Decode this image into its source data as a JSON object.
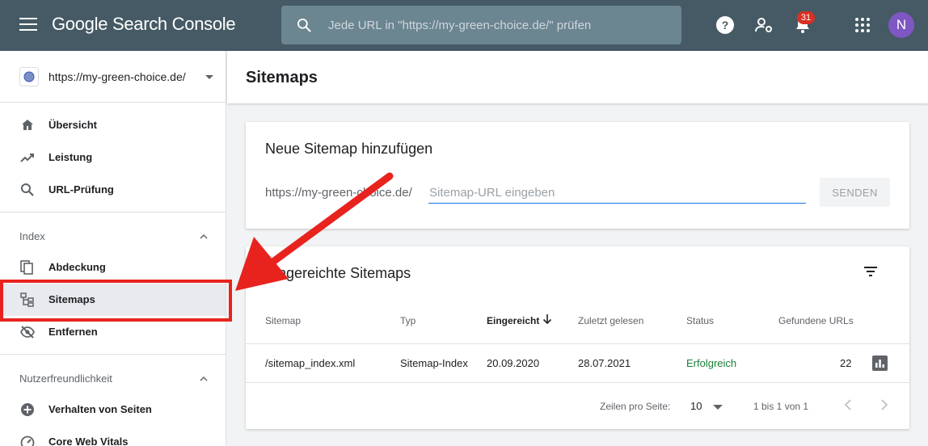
{
  "app": {
    "title": "Google Search Console",
    "search_placeholder": "Jede URL in \"https://my-green-choice.de/\" prüfen",
    "notifications_count": "31",
    "avatar_letter": "N"
  },
  "sidebar": {
    "property": "https://my-green-choice.de/",
    "items_top": [
      {
        "label": "Übersicht"
      },
      {
        "label": "Leistung"
      },
      {
        "label": "URL-Prüfung"
      }
    ],
    "sections": [
      {
        "label": "Index",
        "items": [
          {
            "label": "Abdeckung"
          },
          {
            "label": "Sitemaps"
          },
          {
            "label": "Entfernen"
          }
        ]
      },
      {
        "label": "Nutzerfreundlichkeit",
        "items": [
          {
            "label": "Verhalten von Seiten"
          },
          {
            "label": "Core Web Vitals"
          }
        ]
      }
    ]
  },
  "main": {
    "page_title": "Sitemaps",
    "add_card": {
      "title": "Neue Sitemap hinzufügen",
      "prefix": "https://my-green-choice.de/",
      "input_placeholder": "Sitemap-URL eingeben",
      "send_label": "SENDEN"
    },
    "submitted_card": {
      "title": "Eingereichte Sitemaps",
      "columns": [
        "Sitemap",
        "Typ",
        "Eingereicht",
        "Zuletzt gelesen",
        "Status",
        "Gefundene URLs"
      ],
      "rows": [
        {
          "sitemap": "/sitemap_index.xml",
          "type": "Sitemap-Index",
          "submitted": "20.09.2020",
          "last_read": "28.07.2021",
          "status": "Erfolgreich",
          "urls": "22"
        }
      ],
      "pager": {
        "rows_label": "Zeilen pro Seite:",
        "rows_value": "10",
        "range": "1 bis 1 von 1"
      }
    }
  },
  "colors": {
    "topbar": "#455a64",
    "status_ok": "#188038",
    "annotation": "#e8231d",
    "input_focus": "#1a73e8"
  }
}
